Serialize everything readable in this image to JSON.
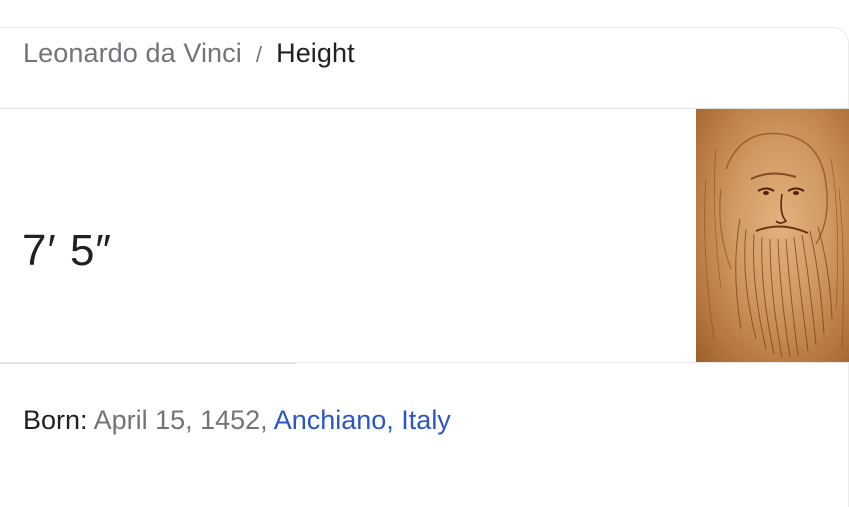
{
  "breadcrumb": {
    "parent": "Leonardo da Vinci",
    "separator": "/",
    "current": "Height"
  },
  "answer": {
    "value": "7′ 5″"
  },
  "portrait": {
    "icon": "portrait-image"
  },
  "born": {
    "label": "Born:",
    "date": "April 15, 1452,",
    "place": "Anchiano, Italy"
  },
  "colors": {
    "link": "#2a56c6",
    "muted": "#70757a",
    "text": "#202124"
  }
}
